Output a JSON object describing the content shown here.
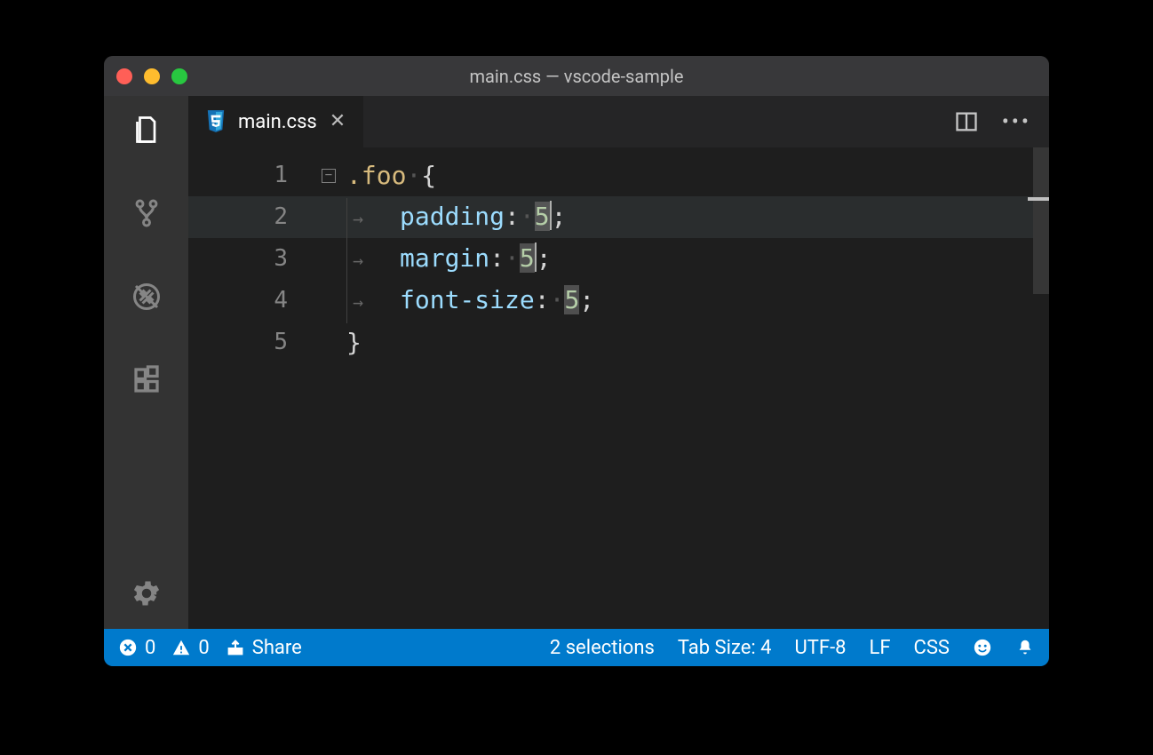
{
  "titlebar": {
    "text": "main.css — vscode-sample"
  },
  "tabs": [
    {
      "label": "main.css",
      "icon": "css-file-icon",
      "active": true,
      "dirty": false
    }
  ],
  "editor_actions": {
    "split": "split-editor-icon",
    "more": "more-icon"
  },
  "editor": {
    "language": "css",
    "lines": [
      {
        "num": 1,
        "tokens": [
          {
            "t": ".foo",
            "c": "selector"
          },
          {
            "t": "·",
            "c": "ws"
          },
          {
            "t": "{",
            "c": "brace"
          }
        ],
        "fold": true
      },
      {
        "num": 2,
        "indent": true,
        "tokens": [
          {
            "t": "padding",
            "c": "prop"
          },
          {
            "t": ":",
            "c": "punct"
          },
          {
            "t": "·",
            "c": "ws"
          },
          {
            "t": "5",
            "c": "num",
            "sel": true,
            "cursor_after": true
          },
          {
            "t": ";",
            "c": "punct"
          }
        ],
        "highlight": true
      },
      {
        "num": 3,
        "indent": true,
        "tokens": [
          {
            "t": "margin",
            "c": "prop"
          },
          {
            "t": ":",
            "c": "punct"
          },
          {
            "t": "·",
            "c": "ws"
          },
          {
            "t": "5",
            "c": "num",
            "sel": true,
            "cursor_after": true
          },
          {
            "t": ";",
            "c": "punct"
          }
        ]
      },
      {
        "num": 4,
        "indent": true,
        "tokens": [
          {
            "t": "font-size",
            "c": "prop"
          },
          {
            "t": ":",
            "c": "punct"
          },
          {
            "t": "·",
            "c": "ws"
          },
          {
            "t": "5",
            "c": "num",
            "sel": true
          },
          {
            "t": ";",
            "c": "punct"
          }
        ]
      },
      {
        "num": 5,
        "tokens": [
          {
            "t": "}",
            "c": "brace"
          }
        ]
      }
    ]
  },
  "statusbar": {
    "errors": 0,
    "warnings": 0,
    "share": "Share",
    "selections": "2 selections",
    "tab_size": "Tab Size: 4",
    "encoding": "UTF-8",
    "eol": "LF",
    "language": "CSS"
  },
  "activitybar": {
    "items": [
      "explorer",
      "scm",
      "debug",
      "extensions"
    ],
    "bottom": [
      "settings"
    ]
  }
}
